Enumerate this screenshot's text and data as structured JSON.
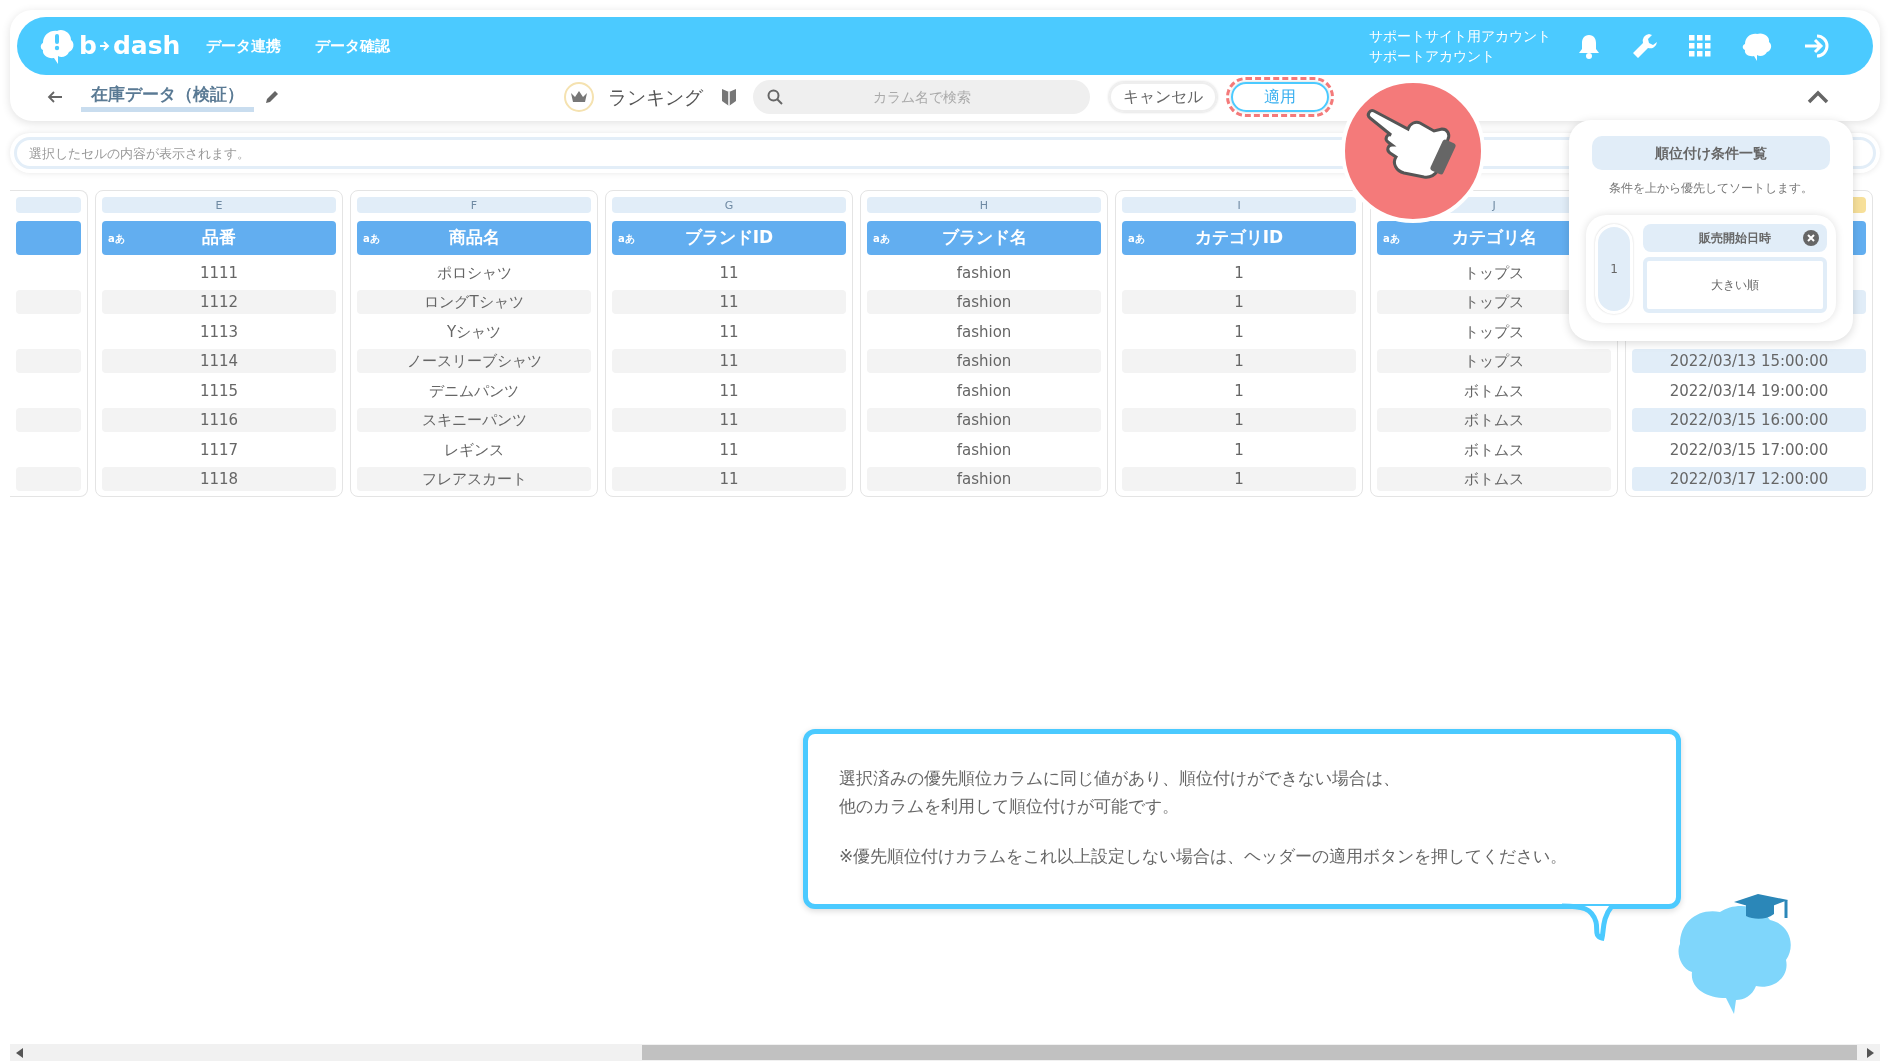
{
  "header": {
    "logo": {
      "left": "b",
      "right": "dash"
    },
    "nav": [
      "データ連携",
      "データ確認"
    ],
    "account": [
      "サポートサイト用アカウント",
      "サポートアカウント"
    ]
  },
  "toolbar": {
    "title": "在庫データ（検証）",
    "mode": "ランキング",
    "search": {
      "placeholder": "カラム名で検索"
    },
    "buttons": [
      {
        "label": "キャンセル",
        "kind": "cancel",
        "highlighted": false
      },
      {
        "label": "適用",
        "kind": "apply",
        "highlighted": true
      }
    ]
  },
  "cell_bar": {
    "placeholder": "選択したセルの内容が表示されます。"
  },
  "columns": [
    {
      "kind": "partial",
      "selected": false
    },
    {
      "kind": "full",
      "letter": "E",
      "type": "aあ",
      "name": "品番",
      "selected": false,
      "cells": [
        "1111",
        "1112",
        "1113",
        "1114",
        "1115",
        "1116",
        "1117",
        "1118"
      ]
    },
    {
      "kind": "full",
      "letter": "F",
      "type": "aあ",
      "name": "商品名",
      "selected": false,
      "cells": [
        "ポロシャツ",
        "ロングTシャツ",
        "Yシャツ",
        "ノースリーブシャツ",
        "デニムパンツ",
        "スキニーパンツ",
        "レギンス",
        "フレアスカート"
      ]
    },
    {
      "kind": "full",
      "letter": "G",
      "type": "aあ",
      "name": "ブランドID",
      "selected": false,
      "cells": [
        "11",
        "11",
        "11",
        "11",
        "11",
        "11",
        "11",
        "11"
      ]
    },
    {
      "kind": "full",
      "letter": "H",
      "type": "aあ",
      "name": "ブランド名",
      "selected": false,
      "cells": [
        "fashion",
        "fashion",
        "fashion",
        "fashion",
        "fashion",
        "fashion",
        "fashion",
        "fashion"
      ]
    },
    {
      "kind": "full",
      "letter": "I",
      "type": "aあ",
      "name": "カテゴリID",
      "selected": false,
      "cells": [
        "1",
        "1",
        "1",
        "1",
        "1",
        "1",
        "1",
        "1"
      ]
    },
    {
      "kind": "full",
      "letter": "J",
      "type": "aあ",
      "name": "カテゴリ名",
      "selected": false,
      "cells": [
        "トップス",
        "トップス",
        "トップス",
        "トップス",
        "ボトムス",
        "ボトムス",
        "ボトムス",
        "ボトムス"
      ]
    },
    {
      "kind": "covered",
      "selected": true,
      "cells": [
        null,
        null,
        null,
        "2022/03/13 15:00:00",
        "2022/03/14 19:00:00",
        "2022/03/15 16:00:00",
        "2022/03/15 17:00:00",
        "2022/03/17 12:00:00"
      ]
    }
  ],
  "ranking_panel": {
    "title": "順位付け条件一覧",
    "note": "条件を上から優先してソートします。",
    "conditions": [
      {
        "rank": "1",
        "column": "販売開始日時",
        "order": "大きい順"
      }
    ]
  },
  "guide_bubble": {
    "paragraphs": [
      [
        "選択済みの優先順位カラムに同じ値があり、順位付けができない場合は、",
        "他のカラムを利用して順位付けが可能です。"
      ],
      [
        "※優先順位付けカラムをこれ以上設定しない場合は、ヘッダーの適用ボタンを押してください。"
      ]
    ]
  }
}
